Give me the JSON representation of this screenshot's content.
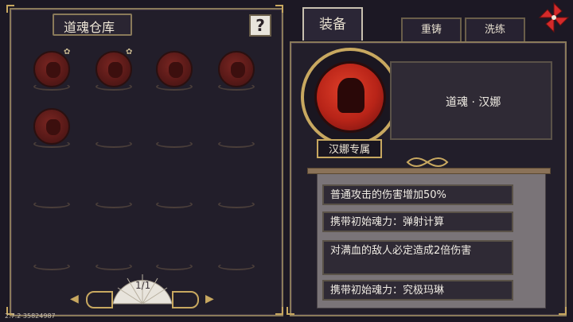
{
  "warehouse": {
    "title": "道魂仓库",
    "help_label": "?",
    "page_indicator": "1/1",
    "prev_arrow": "◀",
    "next_arrow": "▶",
    "items": [
      {
        "name": "soul-1",
        "marked": true
      },
      {
        "name": "soul-2",
        "marked": true
      },
      {
        "name": "soul-3",
        "marked": false
      },
      {
        "name": "soul-4",
        "marked": false
      },
      {
        "name": "soul-5",
        "marked": false
      }
    ],
    "mark_glyph": "✿"
  },
  "tabs": [
    {
      "label": "装备",
      "active": true
    },
    {
      "label": "重铸",
      "active": false
    },
    {
      "label": "洗练",
      "active": false
    }
  ],
  "equipped": {
    "name": "道魂 · 汉娜",
    "exclusive_label": "汉娜专属"
  },
  "effects": [
    "普通攻击的伤害增加50%",
    "携带初始魂力：弹射计算",
    "对满血的敌人必定造成2倍伤害",
    "携带初始魂力：究极玛琳"
  ],
  "version": "2.7.2 35824987",
  "colors": {
    "accent": "#c8a860",
    "orb": "#7a2622",
    "panel": "#221e2a"
  }
}
